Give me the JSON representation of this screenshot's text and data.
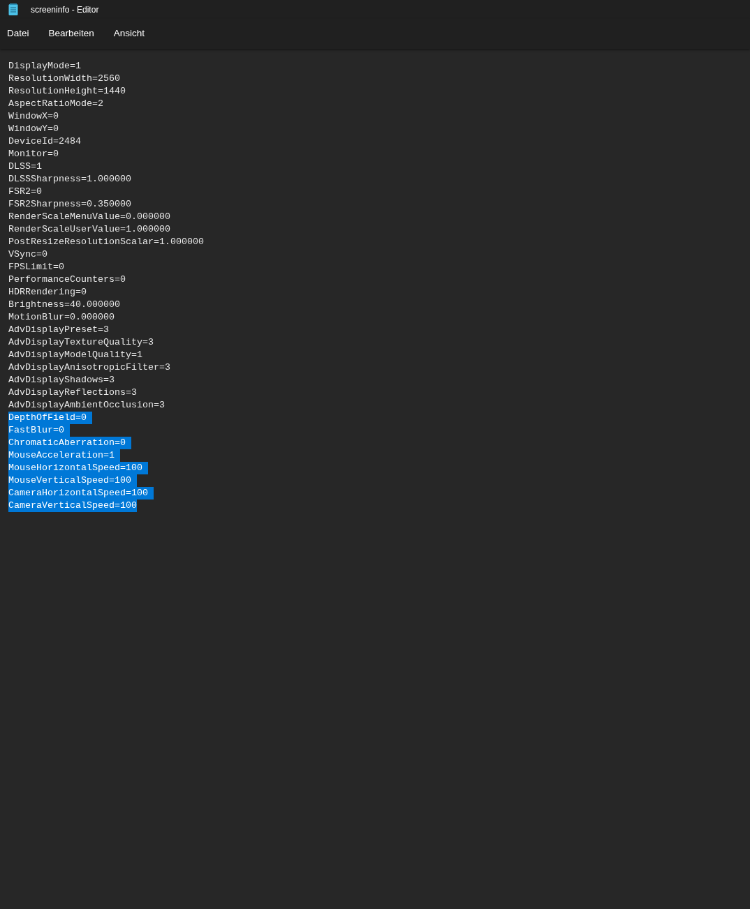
{
  "window": {
    "title": "screeninfo - Editor"
  },
  "menu": [
    "Datei",
    "Bearbeiten",
    "Ansicht"
  ],
  "lines": [
    {
      "text": "DisplayMode=1",
      "selected": false
    },
    {
      "text": "ResolutionWidth=2560",
      "selected": false
    },
    {
      "text": "ResolutionHeight=1440",
      "selected": false
    },
    {
      "text": "AspectRatioMode=2",
      "selected": false
    },
    {
      "text": "WindowX=0",
      "selected": false
    },
    {
      "text": "WindowY=0",
      "selected": false
    },
    {
      "text": "DeviceId=2484",
      "selected": false
    },
    {
      "text": "Monitor=0",
      "selected": false
    },
    {
      "text": "DLSS=1",
      "selected": false
    },
    {
      "text": "DLSSSharpness=1.000000",
      "selected": false
    },
    {
      "text": "FSR2=0",
      "selected": false
    },
    {
      "text": "FSR2Sharpness=0.350000",
      "selected": false
    },
    {
      "text": "RenderScaleMenuValue=0.000000",
      "selected": false
    },
    {
      "text": "RenderScaleUserValue=1.000000",
      "selected": false
    },
    {
      "text": "PostResizeResolutionScalar=1.000000",
      "selected": false
    },
    {
      "text": "VSync=0",
      "selected": false
    },
    {
      "text": "FPSLimit=0",
      "selected": false
    },
    {
      "text": "PerformanceCounters=0",
      "selected": false
    },
    {
      "text": "HDRRendering=0",
      "selected": false
    },
    {
      "text": "Brightness=40.000000",
      "selected": false
    },
    {
      "text": "MotionBlur=0.000000",
      "selected": false
    },
    {
      "text": "AdvDisplayPreset=3",
      "selected": false
    },
    {
      "text": "AdvDisplayTextureQuality=3",
      "selected": false
    },
    {
      "text": "AdvDisplayModelQuality=1",
      "selected": false
    },
    {
      "text": "AdvDisplayAnisotropicFilter=3",
      "selected": false
    },
    {
      "text": "AdvDisplayShadows=3",
      "selected": false
    },
    {
      "text": "AdvDisplayReflections=3",
      "selected": false
    },
    {
      "text": "AdvDisplayAmbientOcclusion=3",
      "selected": false
    },
    {
      "text": "DepthOfField=0",
      "selected": true
    },
    {
      "text": "FastBlur=0",
      "selected": true
    },
    {
      "text": "ChromaticAberration=0",
      "selected": true
    },
    {
      "text": "MouseAcceleration=1",
      "selected": true
    },
    {
      "text": "MouseHorizontalSpeed=100",
      "selected": true
    },
    {
      "text": "MouseVerticalSpeed=100",
      "selected": true
    },
    {
      "text": "CameraHorizontalSpeed=100",
      "selected": true
    },
    {
      "text": "CameraVerticalSpeed=100",
      "selected": true
    }
  ]
}
